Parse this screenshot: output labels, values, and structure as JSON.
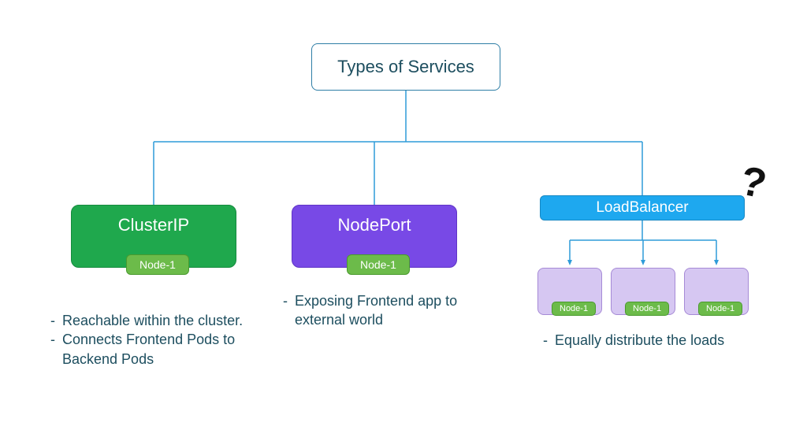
{
  "chart_data": {
    "type": "tree",
    "title": "Types of Services",
    "root": "Types of Services",
    "children": [
      {
        "name": "ClusterIP",
        "color": "#1fa84d",
        "badge": "Node-1",
        "description": [
          "Reachable within the cluster.",
          "Connects Frontend Pods to Backend Pods"
        ]
      },
      {
        "name": "NodePort",
        "color": "#7849e6",
        "badge": "Node-1",
        "description": [
          "Exposing Frontend app to external world"
        ]
      },
      {
        "name": "LoadBalancer",
        "color": "#1ea8ef",
        "annotation": "?",
        "subnodes": [
          {
            "badge": "Node-1"
          },
          {
            "badge": "Node-1"
          },
          {
            "badge": "Node-1"
          }
        ],
        "description": [
          "Equally distribute the loads"
        ]
      }
    ]
  },
  "root_label": "Types of Services",
  "cluster_ip": {
    "label": "ClusterIP",
    "badge": "Node-1"
  },
  "node_port": {
    "label": "NodePort",
    "badge": "Node-1"
  },
  "load_balancer": {
    "label": "LoadBalancer"
  },
  "sub_badges": {
    "b1": "Node-1",
    "b2": "Node-1",
    "b3": "Node-1"
  },
  "qmark": "?",
  "desc_cluster": {
    "line1": "Reachable within the cluster.",
    "line2": "Connects Frontend Pods to Backend Pods"
  },
  "desc_nodeport": {
    "line1": "Exposing Frontend app to external world"
  },
  "desc_lb": {
    "line1": "Equally distribute the loads"
  }
}
